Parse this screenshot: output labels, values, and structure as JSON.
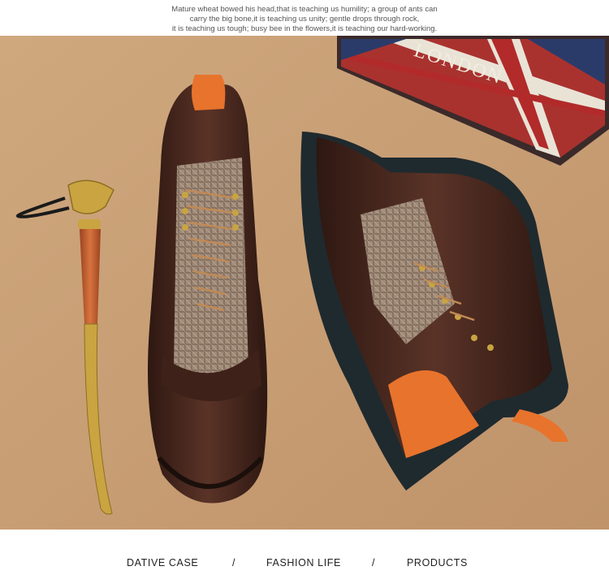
{
  "caption": {
    "line1": "Mature wheat bowed his head,that is teaching us humility; a group of ants can",
    "line2": "carry the big bone,it is teaching us unity; gentle drops through rock,",
    "line3": "it is teaching us tough; busy bee in the flowers,it is teaching our hard-working."
  },
  "photo": {
    "box_sign": "LONDON",
    "colors": {
      "background": "#c9a27a",
      "leather": "#3e2118",
      "orange": "#e8732c",
      "tweed": "#9a8676",
      "sole": "#1f2a2e",
      "brass": "#c9a441",
      "handle": "#c0562a"
    }
  },
  "footer": {
    "item1": "DATIVE CASE",
    "sep1": "/",
    "item2": "FASHION LIFE",
    "sep2": "/",
    "item3": "PRODUCTS"
  }
}
